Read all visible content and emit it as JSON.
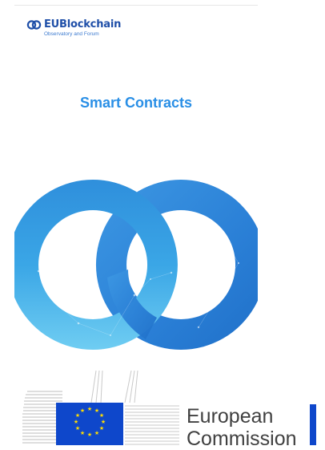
{
  "brand": {
    "name": "EUBlockchain",
    "tagline": "Observatory and Forum",
    "logo_icon": "linked-rings-icon"
  },
  "page": {
    "title": "Smart Contracts"
  },
  "hero": {
    "icon": "interlocked-rings-network-icon"
  },
  "footer": {
    "logo_icon": "eu-flag-building-icon",
    "org_line1": "European",
    "org_line2": "Commission"
  },
  "colors": {
    "brand_blue": "#1f4fa8",
    "title_blue": "#2a8fe6",
    "ring_light": "#3fb2ea",
    "ring_dark": "#2a7fd6",
    "eu_blue": "#0e47cb",
    "eu_star": "#ffdd00"
  }
}
